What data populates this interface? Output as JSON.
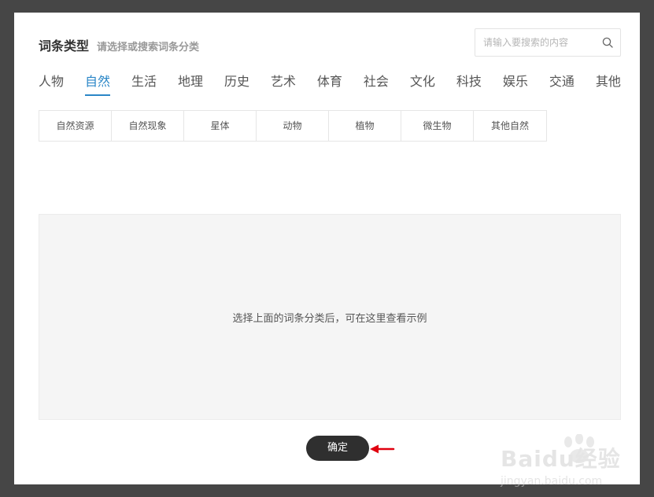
{
  "header": {
    "title": "词条类型",
    "subtitle": "请选择或搜索词条分类"
  },
  "search": {
    "placeholder": "请输入要搜索的内容",
    "icon": "search-icon"
  },
  "categories": [
    {
      "label": "人物",
      "active": false
    },
    {
      "label": "自然",
      "active": true
    },
    {
      "label": "生活",
      "active": false
    },
    {
      "label": "地理",
      "active": false
    },
    {
      "label": "历史",
      "active": false
    },
    {
      "label": "艺术",
      "active": false
    },
    {
      "label": "体育",
      "active": false
    },
    {
      "label": "社会",
      "active": false
    },
    {
      "label": "文化",
      "active": false
    },
    {
      "label": "科技",
      "active": false
    },
    {
      "label": "娱乐",
      "active": false
    },
    {
      "label": "交通",
      "active": false
    },
    {
      "label": "其他",
      "active": false
    }
  ],
  "subcategories": [
    "自然资源",
    "自然现象",
    "星体",
    "动物",
    "植物",
    "微生物",
    "其他自然"
  ],
  "preview": {
    "message": "选择上面的词条分类后，可在这里查看示例"
  },
  "footer": {
    "confirm_label": "确定"
  },
  "watermark": {
    "brand": "Baidu经验",
    "url": "jingyan.baidu.com"
  },
  "colors": {
    "accent": "#2a86c7",
    "button": "#2f2f2f",
    "backdrop": "#464646",
    "arrow": "#e0000f"
  }
}
